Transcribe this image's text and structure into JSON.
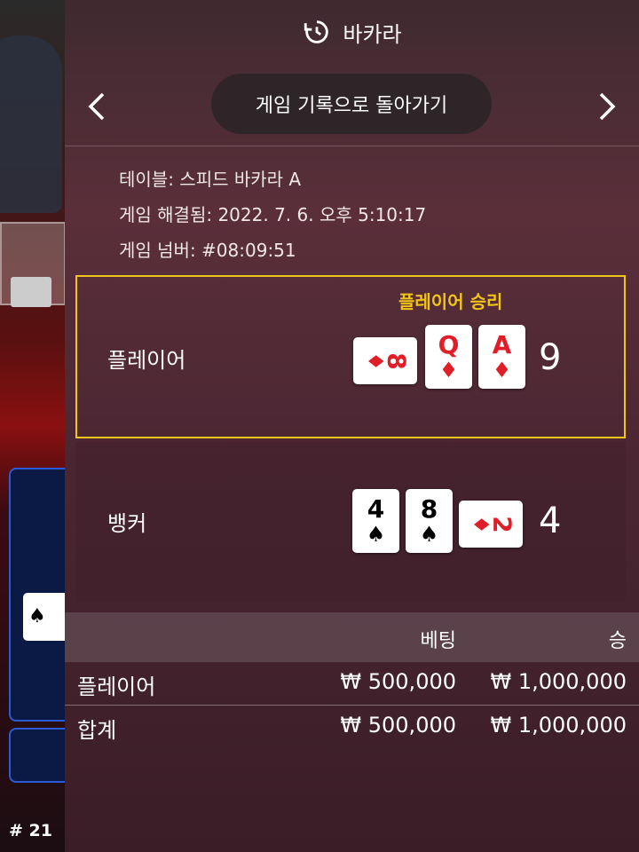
{
  "round_number": "# 21",
  "header": {
    "title": "바카라",
    "icon": "history-icon"
  },
  "nav": {
    "back_label": "게임 기록으로 돌아가기",
    "prev_icon": "chevron-left-icon",
    "next_icon": "chevron-right-icon"
  },
  "info": {
    "table": "테이블: 스피드 바카라 A",
    "resolved": "게임 해결됨: 2022. 7. 6. 오후 5:10:17",
    "game_number": "게임 넘버: #08:09:51"
  },
  "player": {
    "label": "플레이어",
    "result": "플레이어 승리",
    "total": "9",
    "cards": [
      {
        "rank": "8",
        "suit": "♦",
        "color": "red",
        "orientation": "sideways"
      },
      {
        "rank": "Q",
        "suit": "♦",
        "color": "red",
        "orientation": "upright"
      },
      {
        "rank": "A",
        "suit": "♦",
        "color": "red",
        "orientation": "upright"
      }
    ]
  },
  "banker": {
    "label": "뱅커",
    "total": "4",
    "cards": [
      {
        "rank": "4",
        "suit": "♠",
        "color": "black",
        "orientation": "upright"
      },
      {
        "rank": "8",
        "suit": "♠",
        "color": "black",
        "orientation": "upright"
      },
      {
        "rank": "2",
        "suit": "♦",
        "color": "red",
        "orientation": "sideways"
      }
    ]
  },
  "bets_table": {
    "headers": {
      "bet": "베팅",
      "win": "승"
    },
    "rows": [
      {
        "label": "플레이어",
        "bet": "₩ 500,000",
        "win": "₩ 1,000,000"
      },
      {
        "label": "합계",
        "bet": "₩ 500,000",
        "win": "₩ 1,000,000"
      }
    ]
  },
  "colors": {
    "accent": "#f0c419",
    "red_suit": "#e01e28",
    "panel": "#4a2632"
  }
}
